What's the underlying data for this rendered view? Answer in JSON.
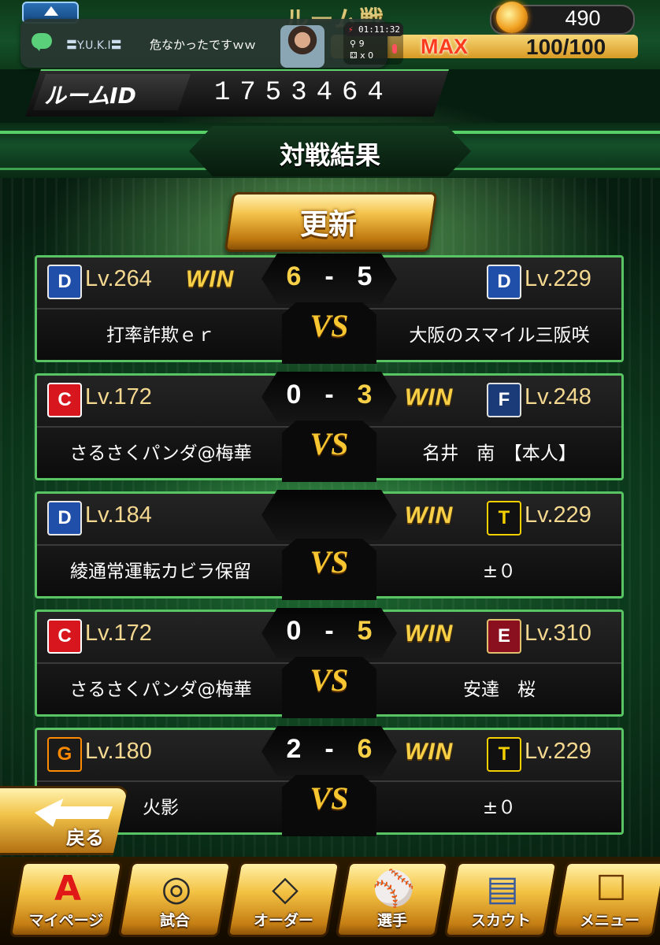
{
  "header": {
    "mode_title": "ルーム戦",
    "coins": "490",
    "stamina_max_label": "MAX",
    "stamina": "100/100"
  },
  "notification": {
    "sender": "〓Y.U.K.I〓",
    "message": "危なかったですｗｗ",
    "timer": "01:11:32",
    "members": "9",
    "gifts": "x 0"
  },
  "room": {
    "label": "ルームID",
    "id": "1753464"
  },
  "section_title": "対戦結果",
  "update_button": "更新",
  "matches": [
    {
      "left_team": "dragons",
      "left_lv": "Lv.264",
      "left_name": "打率詐欺ｅｒ",
      "left_win": "WIN",
      "score_left": "6",
      "score_right": "5",
      "right_team": "dragons",
      "right_lv": "Lv.229",
      "right_name": "大阪のスマイル三阪咲",
      "right_win": ""
    },
    {
      "left_team": "carp",
      "left_lv": "Lv.172",
      "left_name": "さるさくパンダ@梅華",
      "left_win": "",
      "score_left": "0",
      "score_right": "3",
      "right_team": "fighters",
      "right_lv": "Lv.248",
      "right_name": "名井　南　【本人】",
      "right_win": "WIN"
    },
    {
      "left_team": "dragons",
      "left_lv": "Lv.184",
      "left_name": "綾通常運転カビラ保留",
      "left_win": "",
      "score_left": "",
      "score_right": "",
      "right_team": "tigers",
      "right_lv": "Lv.229",
      "right_name": "±０",
      "right_win": "WIN"
    },
    {
      "left_team": "carp",
      "left_lv": "Lv.172",
      "left_name": "さるさくパンダ@梅華",
      "left_win": "",
      "score_left": "0",
      "score_right": "5",
      "right_team": "eagles",
      "right_lv": "Lv.310",
      "right_name": "安達　桜",
      "right_win": "WIN"
    },
    {
      "left_team": "giants",
      "left_lv": "Lv.180",
      "left_name": "火影",
      "left_win": "",
      "score_left": "2",
      "score_right": "6",
      "right_team": "tigers",
      "right_lv": "Lv.229",
      "right_name": "±０",
      "right_win": "WIN"
    }
  ],
  "vs_label": "VS",
  "dash": "-",
  "team_glyphs": {
    "dragons": "D",
    "carp": "C",
    "fighters": "F",
    "tigers": "T",
    "eagles": "E",
    "giants": "G"
  },
  "back_button": "戻る",
  "nav": [
    {
      "label": "マイページ",
      "icon": "A"
    },
    {
      "label": "試合",
      "icon": "stadium-icon"
    },
    {
      "label": "オーダー",
      "icon": "field-icon"
    },
    {
      "label": "選手",
      "icon": "player-icon"
    },
    {
      "label": "スカウト",
      "icon": "card-icon"
    },
    {
      "label": "メニュー",
      "icon": "menu-character-icon"
    }
  ],
  "colors": {
    "accent_green": "#59c463",
    "gold": "#f7d048",
    "level_text": "#f4d890"
  }
}
